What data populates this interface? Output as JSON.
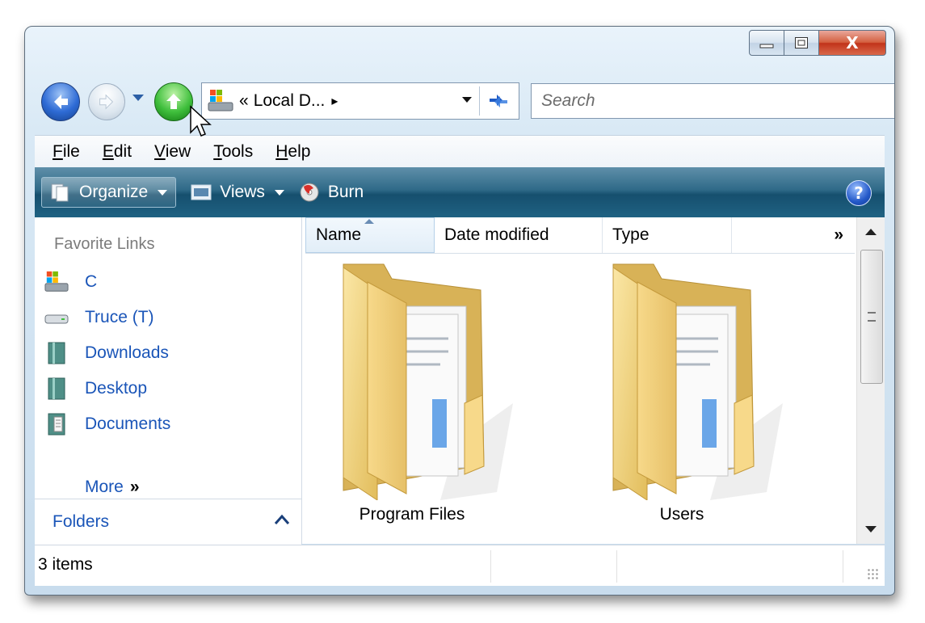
{
  "window": {
    "caption_buttons": {
      "close_glyph": "X"
    }
  },
  "navigation": {
    "address_breadcrumb_prefix": "«",
    "address_path": "Local D...",
    "address_separator": "▸",
    "search_placeholder": "Search"
  },
  "menubar": {
    "items": [
      {
        "mnemonic": "F",
        "rest": "ile"
      },
      {
        "mnemonic": "E",
        "rest": "dit"
      },
      {
        "mnemonic": "V",
        "rest": "iew"
      },
      {
        "mnemonic": "T",
        "rest": "ools"
      },
      {
        "mnemonic": "H",
        "rest": "elp"
      }
    ]
  },
  "commandbar": {
    "organize": "Organize",
    "views": "Views",
    "burn": "Burn",
    "help_glyph": "?"
  },
  "nav_pane": {
    "favorites_title": "Favorite Links",
    "links": [
      {
        "label": "C",
        "icon": "drive-c-icon"
      },
      {
        "label": "Truce (T)",
        "icon": "hard-drive-icon"
      },
      {
        "label": "Downloads",
        "icon": "folder-downloads-icon"
      },
      {
        "label": "Desktop",
        "icon": "folder-desktop-icon"
      },
      {
        "label": "Documents",
        "icon": "folder-documents-icon"
      }
    ],
    "more": "More",
    "more_glyph": "»",
    "folders": "Folders"
  },
  "content": {
    "columns": [
      "Name",
      "Date modified",
      "Type"
    ],
    "columns_overflow": "»",
    "items": [
      {
        "name": "Program Files"
      },
      {
        "name": "Users"
      }
    ]
  },
  "statusbar": {
    "item_count": "3 items"
  },
  "colors": {
    "link": "#1a55b8",
    "command_bar": "#1f6283",
    "close_button": "#c1331a"
  }
}
